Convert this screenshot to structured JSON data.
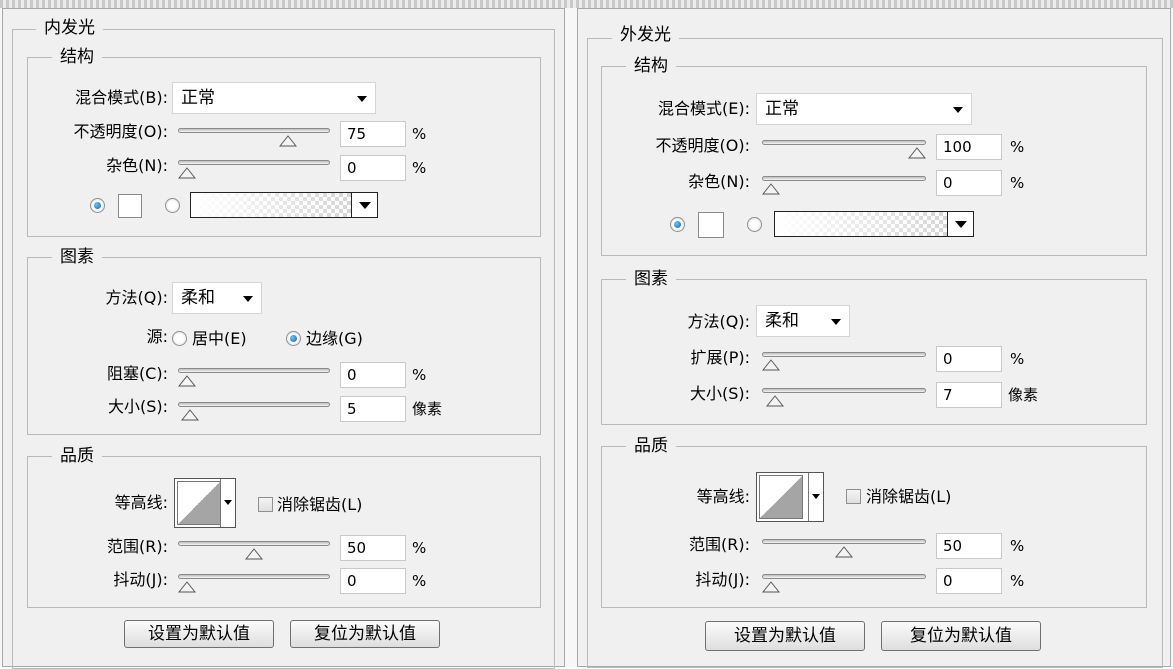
{
  "inner_glow": {
    "title": "内发光",
    "structure": {
      "title": "结构",
      "blend_mode_label": "混合模式(B):",
      "blend_mode_value": "正常",
      "opacity_label": "不透明度(O):",
      "opacity_value": "75",
      "opacity_unit": "%",
      "opacity_fraction": 0.75,
      "noise_label": "杂色(N):",
      "noise_value": "0",
      "noise_unit": "%",
      "noise_fraction": 0.0,
      "color_radio_selected": true,
      "gradient_radio_selected": false
    },
    "elements": {
      "title": "图素",
      "technique_label": "方法(Q):",
      "technique_value": "柔和",
      "source_label": "源:",
      "source_center_label": "居中(E)",
      "source_edge_label": "边缘(G)",
      "source_selected": "edge",
      "choke_label": "阻塞(C):",
      "choke_value": "0",
      "choke_unit": "%",
      "choke_fraction": 0.0,
      "size_label": "大小(S):",
      "size_value": "5",
      "size_unit": "像素",
      "size_fraction": 0.02
    },
    "quality": {
      "title": "品质",
      "contour_label": "等高线:",
      "anti_alias_label": "消除锯齿(L)",
      "anti_alias_checked": false,
      "range_label": "范围(R):",
      "range_value": "50",
      "range_unit": "%",
      "range_fraction": 0.5,
      "jitter_label": "抖动(J):",
      "jitter_value": "0",
      "jitter_unit": "%",
      "jitter_fraction": 0.0
    },
    "make_default_label": "设置为默认值",
    "reset_default_label": "复位为默认值"
  },
  "outer_glow": {
    "title": "外发光",
    "structure": {
      "title": "结构",
      "blend_mode_label": "混合模式(E):",
      "blend_mode_value": "正常",
      "opacity_label": "不透明度(O):",
      "opacity_value": "100",
      "opacity_unit": "%",
      "opacity_fraction": 1.0,
      "noise_label": "杂色(N):",
      "noise_value": "0",
      "noise_unit": "%",
      "noise_fraction": 0.0,
      "color_radio_selected": true,
      "gradient_radio_selected": false
    },
    "elements": {
      "title": "图素",
      "technique_label": "方法(Q):",
      "technique_value": "柔和",
      "spread_label": "扩展(P):",
      "spread_value": "0",
      "spread_unit": "%",
      "spread_fraction": 0.0,
      "size_label": "大小(S):",
      "size_value": "7",
      "size_unit": "像素",
      "size_fraction": 0.03
    },
    "quality": {
      "title": "品质",
      "contour_label": "等高线:",
      "anti_alias_label": "消除锯齿(L)",
      "anti_alias_checked": false,
      "range_label": "范围(R):",
      "range_value": "50",
      "range_unit": "%",
      "range_fraction": 0.5,
      "jitter_label": "抖动(J):",
      "jitter_value": "0",
      "jitter_unit": "%",
      "jitter_fraction": 0.0
    },
    "make_default_label": "设置为默认值",
    "reset_default_label": "复位为默认值"
  }
}
